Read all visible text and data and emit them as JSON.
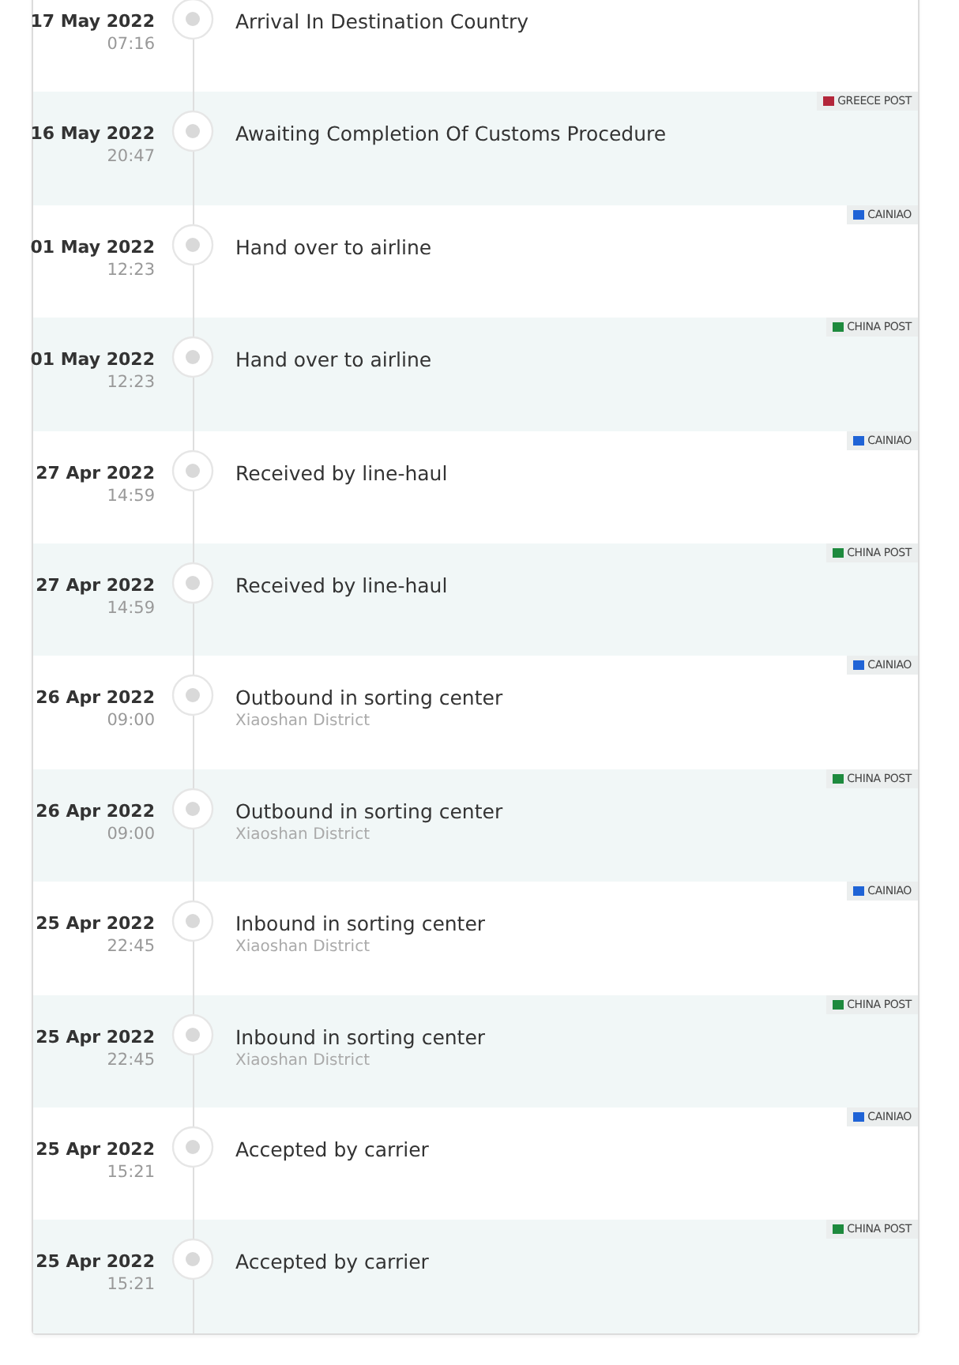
{
  "events": [
    {
      "date": "17 May 2022",
      "time": "07:16",
      "status": "Arrival In Destination Country"
    },
    {
      "date": "16 May 2022",
      "time": "20:47",
      "status": "Awaiting Completion Of Customs Procedure",
      "carrier": {
        "name": "GREECE POST",
        "color": "#b3263a"
      }
    },
    {
      "date": "01 May 2022",
      "time": "12:23",
      "status": "Hand over to airline",
      "carrier": {
        "name": "CAINIAO",
        "color": "#1f63d6"
      }
    },
    {
      "date": "01 May 2022",
      "time": "12:23",
      "status": "Hand over to airline",
      "carrier": {
        "name": "CHINA POST",
        "color": "#1e8a3e"
      }
    },
    {
      "date": "27 Apr 2022",
      "time": "14:59",
      "status": "Received by line-haul",
      "carrier": {
        "name": "CAINIAO",
        "color": "#1f63d6"
      }
    },
    {
      "date": "27 Apr 2022",
      "time": "14:59",
      "status": "Received by line-haul",
      "carrier": {
        "name": "CHINA POST",
        "color": "#1e8a3e"
      }
    },
    {
      "date": "26 Apr 2022",
      "time": "09:00",
      "status": "Outbound in sorting center",
      "location": "Xiaoshan District",
      "carrier": {
        "name": "CAINIAO",
        "color": "#1f63d6"
      }
    },
    {
      "date": "26 Apr 2022",
      "time": "09:00",
      "status": "Outbound in sorting center",
      "location": "Xiaoshan District",
      "carrier": {
        "name": "CHINA POST",
        "color": "#1e8a3e"
      }
    },
    {
      "date": "25 Apr 2022",
      "time": "22:45",
      "status": "Inbound in sorting center",
      "location": "Xiaoshan District",
      "carrier": {
        "name": "CAINIAO",
        "color": "#1f63d6"
      }
    },
    {
      "date": "25 Apr 2022",
      "time": "22:45",
      "status": "Inbound in sorting center",
      "location": "Xiaoshan District",
      "carrier": {
        "name": "CHINA POST",
        "color": "#1e8a3e"
      }
    },
    {
      "date": "25 Apr 2022",
      "time": "15:21",
      "status": "Accepted by carrier",
      "carrier": {
        "name": "CAINIAO",
        "color": "#1f63d6"
      }
    },
    {
      "date": "25 Apr 2022",
      "time": "15:21",
      "status": "Accepted by carrier",
      "carrier": {
        "name": "CHINA POST",
        "color": "#1e8a3e"
      }
    }
  ]
}
